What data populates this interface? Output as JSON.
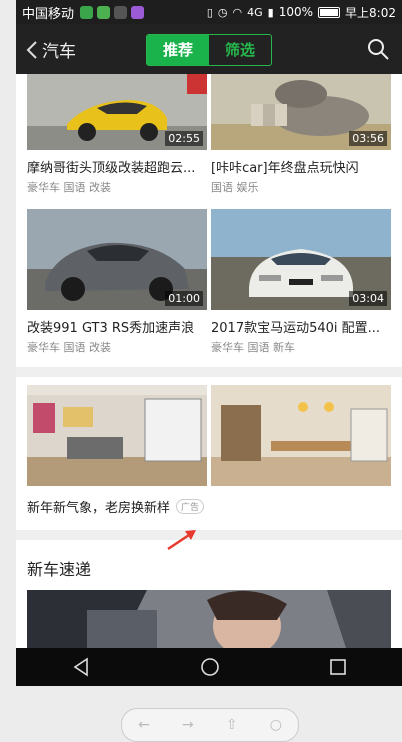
{
  "statusbar": {
    "carrier": "中国移动",
    "network": "4G",
    "battery": "100%",
    "time": "早上8:02"
  },
  "navbar": {
    "back_label": "汽车",
    "tab_recommend": "推荐",
    "tab_filter": "筛选"
  },
  "videos": [
    {
      "title": "摩纳哥街头顶级改装超跑云...",
      "tags": "豪华车 国语 改装",
      "duration": "02:55"
    },
    {
      "title": "[咔咔car]年终盘点玩快闪",
      "tags": "国语 娱乐",
      "duration": "03:56"
    },
    {
      "title": "改装991 GT3 RS秀加速声浪",
      "tags": "豪华车 国语 改装",
      "duration": "01:00"
    },
    {
      "title": "2017款宝马运动540i 配置...",
      "tags": "豪华车 国语 新车",
      "duration": "03:04"
    }
  ],
  "ad": {
    "title": "新年新气象，老房换新样",
    "tag": "广告"
  },
  "section": {
    "title": "新车速递"
  },
  "colors": {
    "accent": "#1ab34b",
    "navbar": "#222222",
    "annotation": "#e8372b"
  },
  "icons": [
    "back-chevron-icon",
    "search-icon",
    "play-thumbnail",
    "annotation-arrow",
    "nav-back-icon",
    "nav-home-icon",
    "nav-recent-icon"
  ]
}
